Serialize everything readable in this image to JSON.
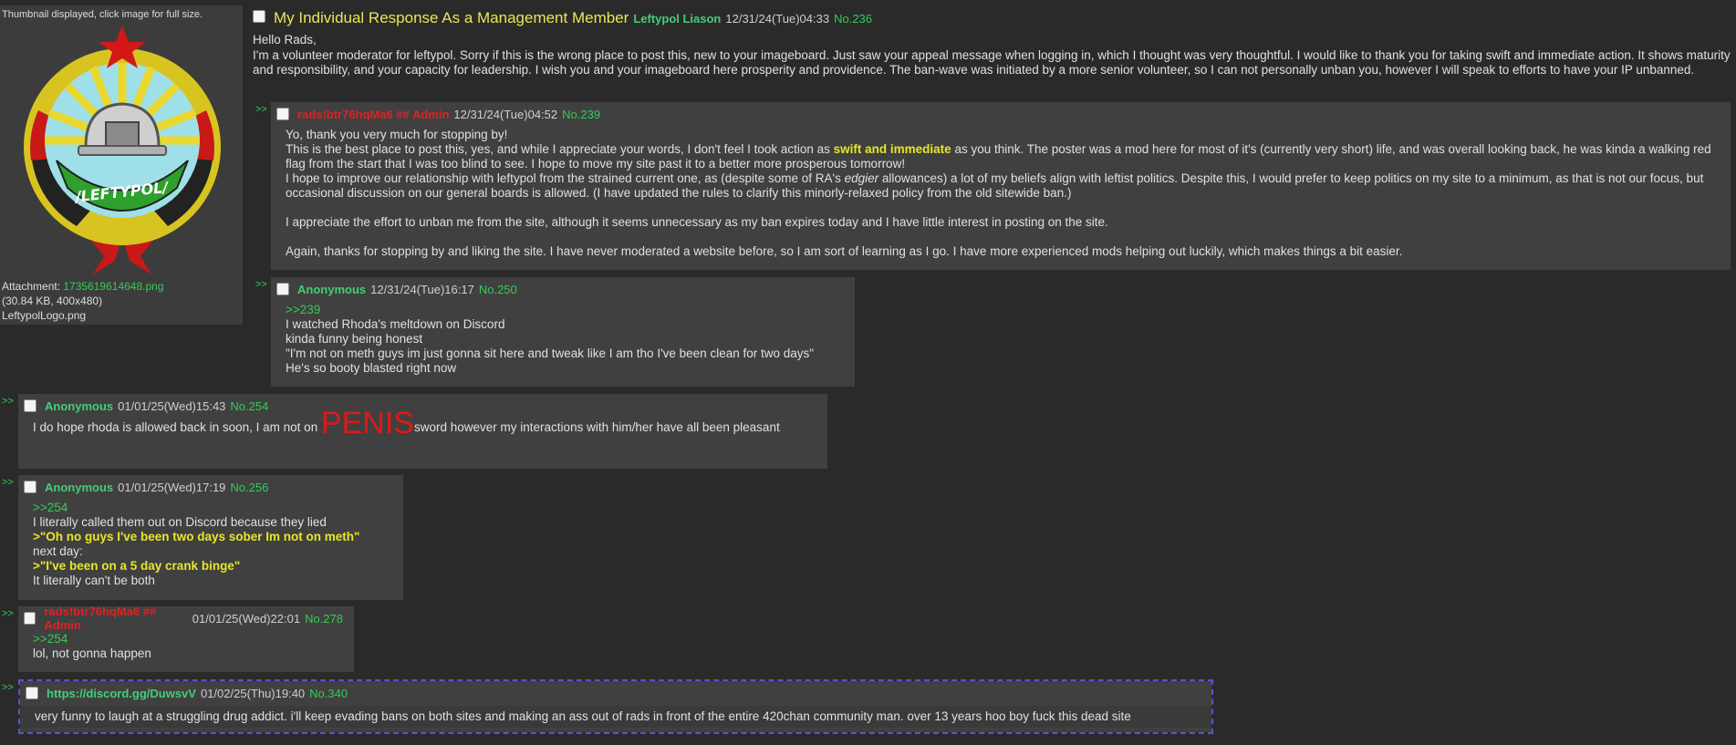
{
  "thumb": {
    "note": "Thumbnail displayed, click image for full size.",
    "attachment_label": "Attachment:",
    "attachment_file": "1735619614648.png",
    "attachment_meta": "(30.84 KB, 400x480)",
    "attachment_orig": "LeftypolLogo.png",
    "emblem_text": "/LEFTYPOL/"
  },
  "op": {
    "title": "My Individual Response As a Management Member",
    "name": "Leftypol Liason",
    "date": "12/31/24(Tue)04:33",
    "no": "No.236",
    "lines": [
      "Hello Rads,",
      "I'm a volunteer moderator for leftypol. Sorry if this is the wrong place to post this, new to your imageboard. Just saw your appeal message when logging in, which I thought was very thoughtful. I would like to thank you for taking swift and immediate action. It shows maturity and responsibility, and your capacity for leadership. I wish you and your imageboard here prosperity and providence. The ban-wave was initiated by a more senior volunteer, so I can not personally unban you, however I will speak to efforts to have your IP unbanned."
    ]
  },
  "arrow": ">>",
  "r239": {
    "name": "rads!btr76hqMa6 ## Admin",
    "date": "12/31/24(Tue)04:52",
    "no": "No.239",
    "l1": "Yo, thank you very much for stopping by!",
    "l2a": "This is the best place to post this, yes, and while I appreciate your words, I don't feel I took action as ",
    "l2hl": "swift and immediate",
    "l2b": " as you think. The poster was a mod here for most of it's (currently very short) life, and was overall looking back, he was kinda a walking red flag from the start that I was too blind to see. I hope to move my site past it to a better more prosperous tomorrow!",
    "l3a": "I hope to improve our relationship with leftypol from the strained current one, as (despite some of RA's ",
    "l3em": "edgier",
    "l3b": " allowances) a lot of my beliefs align with leftist politics. Despite this, I would prefer to keep politics on my site to a minimum, as that is not our focus, but occasional discussion on our general boards is allowed. (I have updated the rules to clarify this minorly-relaxed policy from the old sitewide ban.)",
    "l4": "I appreciate the effort to unban me from the site, although it seems unnecessary as my ban expires today and I have little interest in posting on the site.",
    "l5": "Again, thanks for stopping by and liking the site. I have never moderated a website before, so I am sort of learning as I go. I have more experienced mods helping out luckily, which makes things a bit easier."
  },
  "r250": {
    "name": "Anonymous",
    "date": "12/31/24(Tue)16:17",
    "no": "No.250",
    "quote": ">>239",
    "lines": [
      "I watched Rhoda's meltdown on Discord",
      "kinda funny being honest",
      "\"I'm not on meth guys im just gonna sit here and tweak like I am tho I've been clean for two days\"",
      "He's so booty blasted right now"
    ]
  },
  "r254": {
    "name": "Anonymous",
    "date": "01/01/25(Wed)15:43",
    "no": "No.254",
    "pre": "I do hope rhoda is allowed back in soon, I am not on ",
    "big": "PENIS",
    "post": "sword however my interactions with him/her have all been pleasant"
  },
  "r256": {
    "name": "Anonymous",
    "date": "01/01/25(Wed)17:19",
    "no": "No.256",
    "quote": ">>254",
    "l1": "I literally called them out on Discord because they lied",
    "g1": ">\"Oh no guys I've been two days sober Im not on meth\"",
    "l2": "next day:",
    "g2": ">\"I've been on a 5 day crank binge\"",
    "l3": "It literally can't be both"
  },
  "r278": {
    "name": "rads!btr76hqMa6 ## Admin",
    "date": "01/01/25(Wed)22:01",
    "no": "No.278",
    "quote": ">>254",
    "l1": "lol, not gonna happen"
  },
  "r340": {
    "name": "https://discord.gg/DuwsvV",
    "date": "01/02/25(Thu)19:40",
    "no": "No.340",
    "l1": "very funny to laugh at a struggling drug addict. i'll keep evading bans on both sites and making an ass out of rads in front of the entire 420chan community man. over 13 years hoo boy fuck this dead site"
  }
}
